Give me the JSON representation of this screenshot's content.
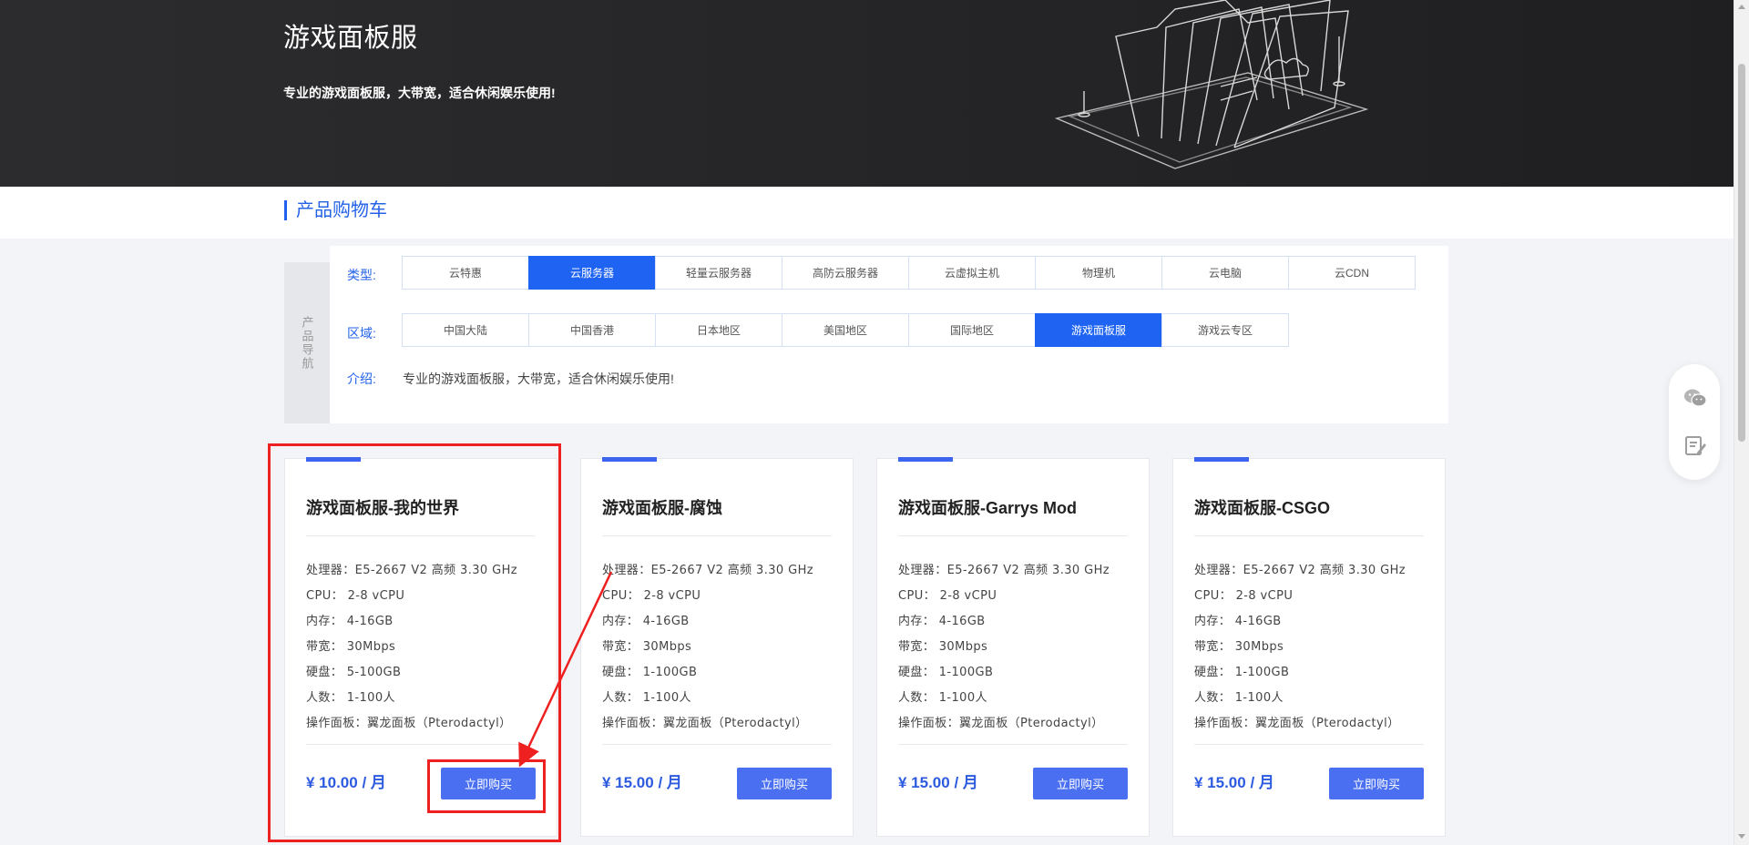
{
  "banner": {
    "title": "游戏面板服",
    "subtitle": "专业的游戏面板服，大带宽，适合休闲娱乐使用!"
  },
  "section": {
    "title": "产品购物车"
  },
  "nav": {
    "side_label": "产品导航",
    "type_label": "类型:",
    "region_label": "区域:",
    "intro_label": "介绍:",
    "intro_text": "专业的游戏面板服，大带宽，适合休闲娱乐使用!",
    "types": [
      "云特惠",
      "云服务器",
      "轻量云服务器",
      "高防云服务器",
      "云虚拟主机",
      "物理机",
      "云电脑",
      "云CDN"
    ],
    "active_type": "云服务器",
    "regions": [
      "中国大陆",
      "中国香港",
      "日本地区",
      "美国地区",
      "国际地区",
      "游戏面板服",
      "游戏云专区"
    ],
    "active_region": "游戏面板服"
  },
  "products": [
    {
      "name": "游戏面板服-我的世界",
      "specs": [
        "处理器：E5-2667 V2 高频 3.30 GHz",
        "CPU： 2-8 vCPU",
        "内存： 4-16GB",
        "带宽： 30Mbps",
        "硬盘： 5-100GB",
        "人数： 1-100人",
        "操作面板：翼龙面板（Pterodactyl）"
      ],
      "price": "¥ 10.00 / 月",
      "buy_label": "立即购买"
    },
    {
      "name": "游戏面板服-腐蚀",
      "specs": [
        "处理器：E5-2667 V2 高频 3.30 GHz",
        "CPU： 2-8 vCPU",
        "内存： 4-16GB",
        "带宽： 30Mbps",
        "硬盘： 1-100GB",
        "人数： 1-100人",
        "操作面板：翼龙面板（Pterodactyl）"
      ],
      "price": "¥ 15.00 / 月",
      "buy_label": "立即购买"
    },
    {
      "name": "游戏面板服-Garrys Mod",
      "specs": [
        "处理器：E5-2667 V2 高频 3.30 GHz",
        "CPU： 2-8 vCPU",
        "内存： 4-16GB",
        "带宽： 30Mbps",
        "硬盘： 1-100GB",
        "人数： 1-100人",
        "操作面板：翼龙面板（Pterodactyl）"
      ],
      "price": "¥ 15.00 / 月",
      "buy_label": "立即购买"
    },
    {
      "name": "游戏面板服-CSGO",
      "specs": [
        "处理器：E5-2667 V2 高频 3.30 GHz",
        "CPU： 2-8 vCPU",
        "内存： 4-16GB",
        "带宽： 30Mbps",
        "硬盘： 1-100GB",
        "人数： 1-100人",
        "操作面板：翼龙面板（Pterodactyl）"
      ],
      "price": "¥ 15.00 / 月",
      "buy_label": "立即购买"
    }
  ],
  "floating": {
    "icons": [
      "wechat-icon",
      "notes-icon"
    ]
  },
  "colors": {
    "accent": "#1f63f2",
    "annotation": "#ee2020",
    "banner_bg": "#262628",
    "price": "#2d5be0"
  }
}
